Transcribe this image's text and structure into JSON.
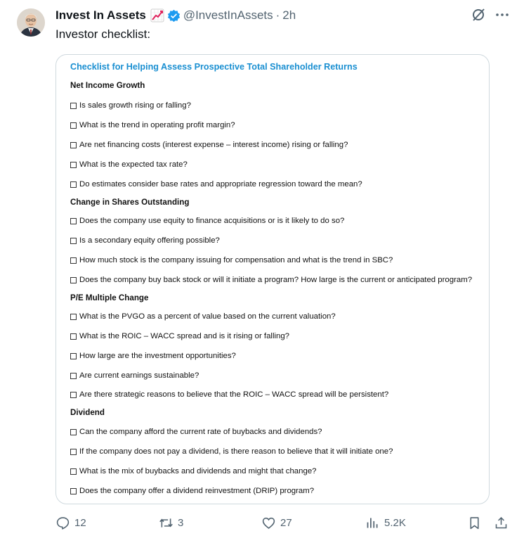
{
  "post": {
    "author": "Invest In Assets",
    "handle": "@InvestInAssets",
    "separator": "·",
    "time": "2h",
    "text": "Investor checklist:"
  },
  "icons": {
    "emoji": "chart-increasing-icon",
    "verified": "verified-badge-icon",
    "grok": "grok-icon",
    "more": "more-icon",
    "reply": "reply-icon",
    "repost": "repost-icon",
    "like": "like-icon",
    "views": "views-icon",
    "bookmark": "bookmark-icon",
    "share": "share-icon"
  },
  "colors": {
    "accent": "#1d9bf0",
    "doc_title": "#1a8fd1",
    "muted": "#536471"
  },
  "document": {
    "title": "Checklist for Helping Assess Prospective Total Shareholder Returns",
    "sections": [
      {
        "heading": "Net Income Growth",
        "items": [
          "Is sales growth rising or falling?",
          "What is the trend in operating profit margin?",
          "Are net financing costs (interest expense – interest income) rising or falling?",
          "What is the expected tax rate?",
          "Do estimates consider base rates and appropriate regression toward the mean?"
        ]
      },
      {
        "heading": "Change in Shares Outstanding",
        "items": [
          "Does the company use equity to finance acquisitions or is it likely to do so?",
          "Is a secondary equity offering possible?",
          "How much stock is the company issuing for compensation and what is the trend in SBC?",
          "Does the company buy back stock or will it initiate a program? How large is the current or anticipated program?"
        ]
      },
      {
        "heading": "P/E Multiple Change",
        "items": [
          "What is the PVGO as a percent of value based on the current valuation?",
          "What is the ROIC – WACC spread and is it rising or falling?",
          "How large are the investment opportunities?",
          "Are current earnings sustainable?",
          "Are there strategic reasons to believe that the ROIC – WACC spread will be persistent?"
        ]
      },
      {
        "heading": "Dividend",
        "items": [
          "Can the company afford the current rate of buybacks and dividends?",
          "If the company does not pay a dividend, is there reason to believe that it will initiate one?",
          "What is the mix of buybacks and dividends and might that change?",
          "Does the company offer a dividend reinvestment (DRIP) program?"
        ]
      }
    ]
  },
  "actions": {
    "replies": "12",
    "reposts": "3",
    "likes": "27",
    "views": "5.2K"
  }
}
